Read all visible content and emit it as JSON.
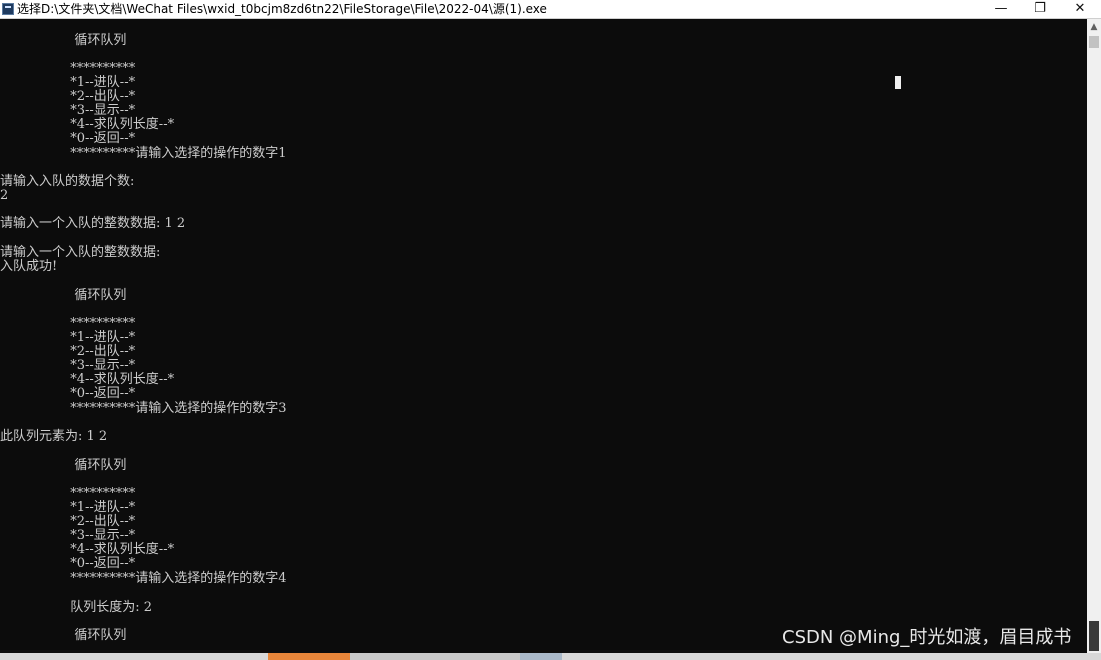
{
  "window": {
    "title": "选择D:\\文件夹\\文档\\WeChat Files\\wxid_t0bcjm8zd6tn22\\FileStorage\\File\\2022-04\\源(1).exe",
    "minimize_glyph": "—",
    "maximize_glyph": "❐",
    "close_glyph": "✕"
  },
  "console": {
    "lines": [
      "                  循环队列",
      "",
      "                 **********",
      "                 *1--进队--*",
      "                 *2--出队--*",
      "                 *3--显示--*",
      "                 *4--求队列长度--*",
      "                 *0--返回--*",
      "                 **********请输入选择的操作的数字1",
      "",
      "请输入入队的数据个数:",
      "2",
      "",
      "请输入一个入队的整数数据: 1 2",
      "",
      "请输入一个入队的整数数据:",
      "入队成功!",
      "",
      "                  循环队列",
      "",
      "                 **********",
      "                 *1--进队--*",
      "                 *2--出队--*",
      "                 *3--显示--*",
      "                 *4--求队列长度--*",
      "                 *0--返回--*",
      "                 **********请输入选择的操作的数字3",
      "",
      "此队列元素为: 1 2",
      "",
      "                  循环队列",
      "",
      "                 **********",
      "                 *1--进队--*",
      "                 *2--出队--*",
      "                 *3--显示--*",
      "                 *4--求队列长度--*",
      "                 *0--返回--*",
      "                 **********请输入选择的操作的数字4",
      "",
      "                 队列长度为: 2",
      "",
      "                  循环队列"
    ]
  },
  "watermark": "CSDN @Ming_时光如渡，眉目成书",
  "scrollbar": {
    "up_glyph": "▲"
  },
  "colors": {
    "console_bg": "#0c0c0c",
    "console_text": "#cccccc",
    "titlebar_bg": "#ffffff"
  }
}
